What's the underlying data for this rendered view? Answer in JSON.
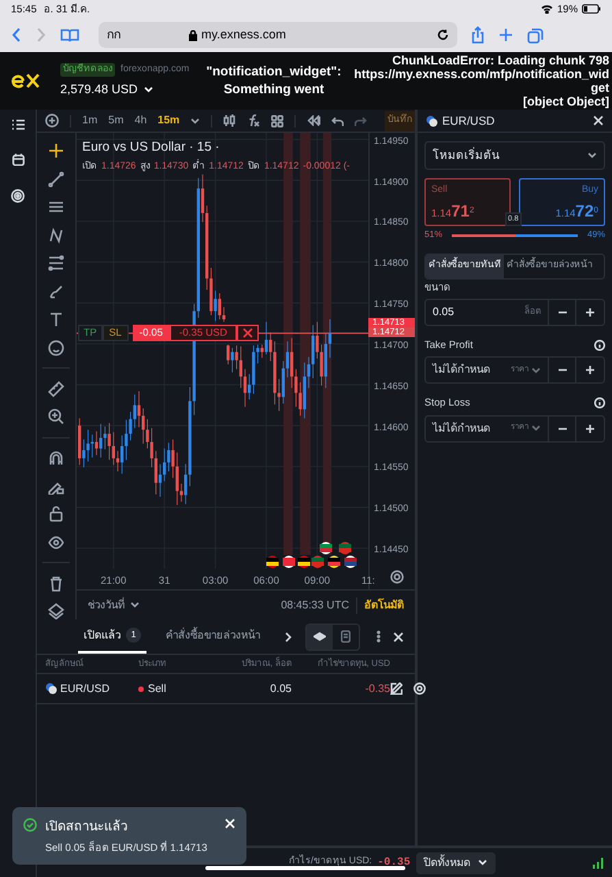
{
  "status_bar": {
    "time": "15:45",
    "date": "อ. 31 มี.ค.",
    "battery": "19%"
  },
  "browser": {
    "field_text": "กก",
    "url": "my.exness.com"
  },
  "header": {
    "account_badge": "บัญชีทดลอง",
    "account_site": "forexonapp.com",
    "balance": "2,579.48 USD",
    "error_middle": [
      "\"notification_widget\":",
      "Something went"
    ],
    "error_right": [
      "ChunkLoadError: Loading chunk 798",
      "https://my.exness.com/mfp/notification_widget",
      "[object Object]"
    ]
  },
  "chart_toolbar": {
    "timeframes": [
      {
        "label": "1m",
        "selected": false
      },
      {
        "label": "5m",
        "selected": false
      },
      {
        "label": "4h",
        "selected": false
      },
      {
        "label": "15m",
        "selected": true
      }
    ],
    "save": "บันทึก"
  },
  "chart": {
    "title": "Euro vs US Dollar · 15 ·",
    "ohlc": [
      {
        "label": "เปิด",
        "value": "1.14726"
      },
      {
        "label": "สูง",
        "value": "1.14730"
      },
      {
        "label": "ต่ำ",
        "value": "1.14712"
      },
      {
        "label": "ปิด",
        "value": "1.14712"
      }
    ],
    "change": "-0.00012 (-",
    "chart_data": {
      "type": "candlestick",
      "ylim": [
        1.14425,
        1.14958
      ],
      "grid": true,
      "categories": [
        null,
        null,
        null,
        null,
        null,
        null,
        null,
        null,
        "21:00",
        null,
        null,
        null,
        null,
        null,
        null,
        null,
        null,
        null,
        null,
        null,
        "31",
        null,
        null,
        null,
        null,
        null,
        null,
        null,
        null,
        null,
        null,
        null,
        "03:00",
        null,
        null,
        null,
        null,
        null,
        null,
        null,
        null,
        null,
        null,
        null,
        "06:00",
        null,
        null,
        null,
        null,
        null,
        null,
        null,
        null,
        null,
        null,
        null,
        "09:00",
        null,
        null,
        null,
        null,
        null,
        null,
        null,
        null,
        null,
        null,
        null,
        null
      ],
      "ref_lines": [
        {
          "axis": "y",
          "value": 1.14713
        }
      ],
      "ohlc": [
        [
          1.146,
          1.14609,
          1.14552,
          1.1456
        ],
        [
          1.1456,
          1.14583,
          1.14549,
          1.1457
        ],
        [
          1.1457,
          1.14595,
          1.14556,
          1.14578
        ],
        [
          1.14578,
          1.14589,
          1.14561,
          1.1458
        ],
        [
          1.1458,
          1.14593,
          1.14564,
          1.14572
        ],
        [
          1.14572,
          1.14602,
          1.14561,
          1.14585
        ],
        [
          1.14585,
          1.14599,
          1.14571,
          1.1459
        ],
        [
          1.1459,
          1.14603,
          1.14558,
          1.14575
        ],
        [
          1.14575,
          1.14592,
          1.14552,
          1.1456
        ],
        [
          1.1456,
          1.14569,
          1.14544,
          1.14555
        ],
        [
          1.14555,
          1.14588,
          1.14541,
          1.14575
        ],
        [
          1.14575,
          1.14607,
          1.14558,
          1.1459
        ],
        [
          1.1459,
          1.14617,
          1.14582,
          1.14608
        ],
        [
          1.14608,
          1.14638,
          1.14597,
          1.14625
        ],
        [
          1.14625,
          1.14642,
          1.14598,
          1.14612
        ],
        [
          1.14612,
          1.14621,
          1.14578,
          1.14595
        ],
        [
          1.14595,
          1.14608,
          1.14572,
          1.1458
        ],
        [
          1.1458,
          1.14597,
          1.14549,
          1.1456
        ],
        [
          1.1456,
          1.14569,
          1.14516,
          1.1453
        ],
        [
          1.1453,
          1.14553,
          1.14513,
          1.1454
        ],
        [
          1.1454,
          1.14572,
          1.14532,
          1.14555
        ],
        [
          1.14555,
          1.14579,
          1.14544,
          1.1457
        ],
        [
          1.1457,
          1.14583,
          1.14536,
          1.1455
        ],
        [
          1.1455,
          1.14567,
          1.14503,
          1.1452
        ],
        [
          1.1452,
          1.14529,
          1.14507,
          1.14515
        ],
        [
          1.14515,
          1.14553,
          1.14504,
          1.1454
        ],
        [
          1.1454,
          1.14647,
          1.14526,
          1.1463
        ],
        [
          1.1463,
          1.14749,
          1.14613,
          1.1474
        ],
        [
          1.1474,
          1.14903,
          1.14732,
          1.1489
        ],
        [
          1.1489,
          1.14907,
          1.14849,
          1.1486
        ],
        [
          1.1486,
          1.14869,
          1.14766,
          1.1478
        ],
        [
          1.1478,
          1.14793,
          1.14735,
          1.1474
        ],
        [
          1.1474,
          1.14765,
          1.14728,
          1.14755
        ],
        [
          1.14755,
          1.14762,
          1.1473,
          1.14735
        ],
        [
          1.14735,
          1.14745,
          1.14727,
          1.1473
        ],
        [
          1.14698,
          1.14699,
          1.14675,
          1.1468
        ],
        [
          1.1468,
          1.14695,
          1.14665,
          1.1469
        ],
        [
          1.1469,
          1.14698,
          1.14669,
          1.1468
        ],
        [
          1.1468,
          1.14697,
          1.14646,
          1.1466
        ],
        [
          1.1466,
          1.14669,
          1.14623,
          1.1464
        ],
        [
          1.1464,
          1.14663,
          1.14632,
          1.1465
        ],
        [
          1.1465,
          1.14698,
          1.14639,
          1.1469
        ],
        [
          1.1469,
          1.14699,
          1.14676,
          1.14695
        ],
        [
          1.14695,
          1.14699,
          1.14683,
          1.1469
        ],
        [
          1.1469,
          1.14727,
          1.14687,
          1.14705
        ],
        [
          1.14705,
          1.14714,
          1.14679,
          1.1469
        ],
        [
          1.1469,
          1.14703,
          1.14626,
          1.1464
        ],
        [
          1.1464,
          1.14657,
          1.14618,
          1.14635
        ],
        [
          1.14635,
          1.14679,
          1.14627,
          1.1467
        ],
        [
          1.1467,
          1.14703,
          1.14659,
          1.1469
        ],
        [
          1.1469,
          1.14707,
          1.14646,
          1.1466
        ],
        [
          1.1466,
          1.14669,
          1.14623,
          1.1464
        ],
        [
          1.1464,
          1.14653,
          1.14612,
          1.1462
        ],
        [
          1.1462,
          1.14677,
          1.14609,
          1.1466
        ],
        [
          1.1466,
          1.14684,
          1.14646,
          1.14675
        ],
        [
          1.14675,
          1.14723,
          1.14658,
          1.1471
        ],
        [
          1.1471,
          1.14727,
          1.14682,
          1.1469
        ],
        [
          1.1469,
          1.14699,
          1.14649,
          1.1466
        ],
        [
          1.1466,
          1.14713,
          1.14646,
          1.147
        ],
        [
          1.147,
          1.1473,
          1.14683,
          1.14713
        ],
        null,
        null,
        null,
        null,
        null,
        null,
        null,
        null,
        null
      ],
      "yticks": [
        {
          "value": 1.1495,
          "label": "1.14950"
        },
        {
          "value": 1.149,
          "label": "1.14900"
        },
        {
          "value": 1.1485,
          "label": "1.14850"
        },
        {
          "value": 1.148,
          "label": "1.14800"
        },
        {
          "value": 1.1475,
          "label": "1.14750"
        },
        {
          "value": 1.147,
          "label": "1.14700"
        },
        {
          "value": 1.1465,
          "label": "1.14650"
        },
        {
          "value": 1.146,
          "label": "1.14600"
        },
        {
          "value": 1.1455,
          "label": "1.14550"
        },
        {
          "value": 1.145,
          "label": "1.14500"
        },
        {
          "value": 1.1445,
          "label": "1.14450"
        }
      ]
    },
    "cut_time_label": "11:",
    "price_tags": [
      "1.14713",
      "1.14712"
    ],
    "position": {
      "tp": "TP",
      "sl": "SL",
      "lots": "-0.05",
      "pnl": "-0.35 USD"
    },
    "range": "ช่วงวันที่",
    "clock": "08:45:33 UTC",
    "auto": "อัตโนมัติ"
  },
  "positions": {
    "tabs": [
      {
        "label": "เปิดแล้ว",
        "count": "1",
        "selected": true
      },
      {
        "label": "คำสั่งซื้อขายล่วงหน้า",
        "selected": false
      }
    ],
    "columns": [
      "สัญลักษณ์",
      "ประเภท",
      "ปริมาณ, ล็อต",
      "กำไร/ขาดทุน, USD"
    ],
    "rows": [
      {
        "symbol": "EUR/USD",
        "side": "Sell",
        "volume": "0.05",
        "pnl": "-0.35"
      }
    ]
  },
  "order_panel": {
    "symbol": "EUR/USD",
    "mode": "โหมดเริ่มต้น",
    "sell": {
      "label": "Sell",
      "prefix": "1.14",
      "big": "71",
      "sup": "2"
    },
    "buy": {
      "label": "Buy",
      "prefix": "1.14",
      "big": "72",
      "sup": "0"
    },
    "spread": "0.8",
    "sentiment": {
      "sell_pct": "51%",
      "buy_pct": "49%",
      "level": 0.51
    },
    "order_tabs": [
      {
        "label": "คำสั่งซื้อขายทันที",
        "selected": true
      },
      {
        "label": "คำสั่งซื้อขายล่วงหน้า",
        "selected": false
      }
    ],
    "fields": [
      {
        "label": "ขนาด",
        "value": "0.05",
        "unit": "ล็อต",
        "kind": "volume"
      },
      {
        "label": "Take Profit",
        "placeholder": "ไม่ได้กำหนด",
        "unit": "ราคา",
        "kind": "price"
      },
      {
        "label": "Stop Loss",
        "placeholder": "ไม่ได้กำหนด",
        "unit": "ราคา",
        "kind": "price"
      }
    ]
  },
  "footer": {
    "pnl_label": "กำไร/ขาดทุน USD:",
    "pnl": "-0.35",
    "close_all": "ปิดทั้งหมด"
  },
  "toast": {
    "title": "เปิดสถานะแล้ว",
    "message": "Sell 0.05 ล็อต EUR/USD ที่ 1.14713"
  }
}
